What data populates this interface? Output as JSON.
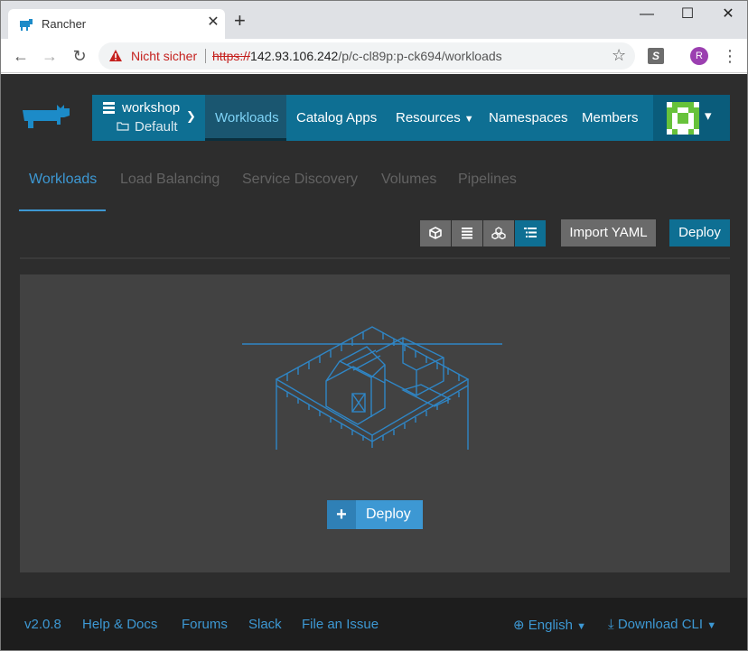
{
  "browser": {
    "tab_title": "Rancher",
    "tab_close": "✕",
    "new_tab": "+",
    "window_controls": {
      "minimize": "—",
      "maximize": "☐",
      "close": "✕"
    },
    "nav": {
      "back": "←",
      "forward": "→",
      "reload": "↻"
    },
    "security_warning": "Nicht sicher",
    "url_scheme": "https://",
    "url_host": "142.93.106.242",
    "url_path": "/p/c-cl89p:p-ck694/workloads",
    "profile_initial": "R",
    "extension_label": "S",
    "icons": [
      "rancher-favicon",
      "warning-icon",
      "star-icon",
      "extension-icon",
      "menu-icon"
    ]
  },
  "header": {
    "cluster_name": "workshop",
    "project_name": "Default",
    "nav_items": [
      {
        "label": "Workloads",
        "active": true
      },
      {
        "label": "Catalog Apps",
        "active": false
      },
      {
        "label": "Resources",
        "active": false,
        "dropdown": true
      },
      {
        "label": "Namespaces",
        "active": false
      },
      {
        "label": "Members",
        "active": false
      }
    ],
    "brand_color": "#0e6f93"
  },
  "subtabs": [
    {
      "label": "Workloads",
      "active": true
    },
    {
      "label": "Load Balancing",
      "active": false
    },
    {
      "label": "Service Discovery",
      "active": false
    },
    {
      "label": "Volumes",
      "active": false
    },
    {
      "label": "Pipelines",
      "active": false
    }
  ],
  "actions": {
    "view_modes": [
      "cube-icon",
      "list-icon",
      "nodes-icon",
      "grouped-list-icon"
    ],
    "active_view": "grouped-list-icon",
    "import_yaml": "Import YAML",
    "deploy": "Deploy"
  },
  "empty_state": {
    "deploy_button": "Deploy",
    "plus": "+"
  },
  "footer": {
    "version": "v2.0.8",
    "links": [
      "Help & Docs",
      "Forums",
      "Slack",
      "File an Issue"
    ],
    "language": "English",
    "download": "Download CLI",
    "accent_color": "#3d98d3"
  }
}
